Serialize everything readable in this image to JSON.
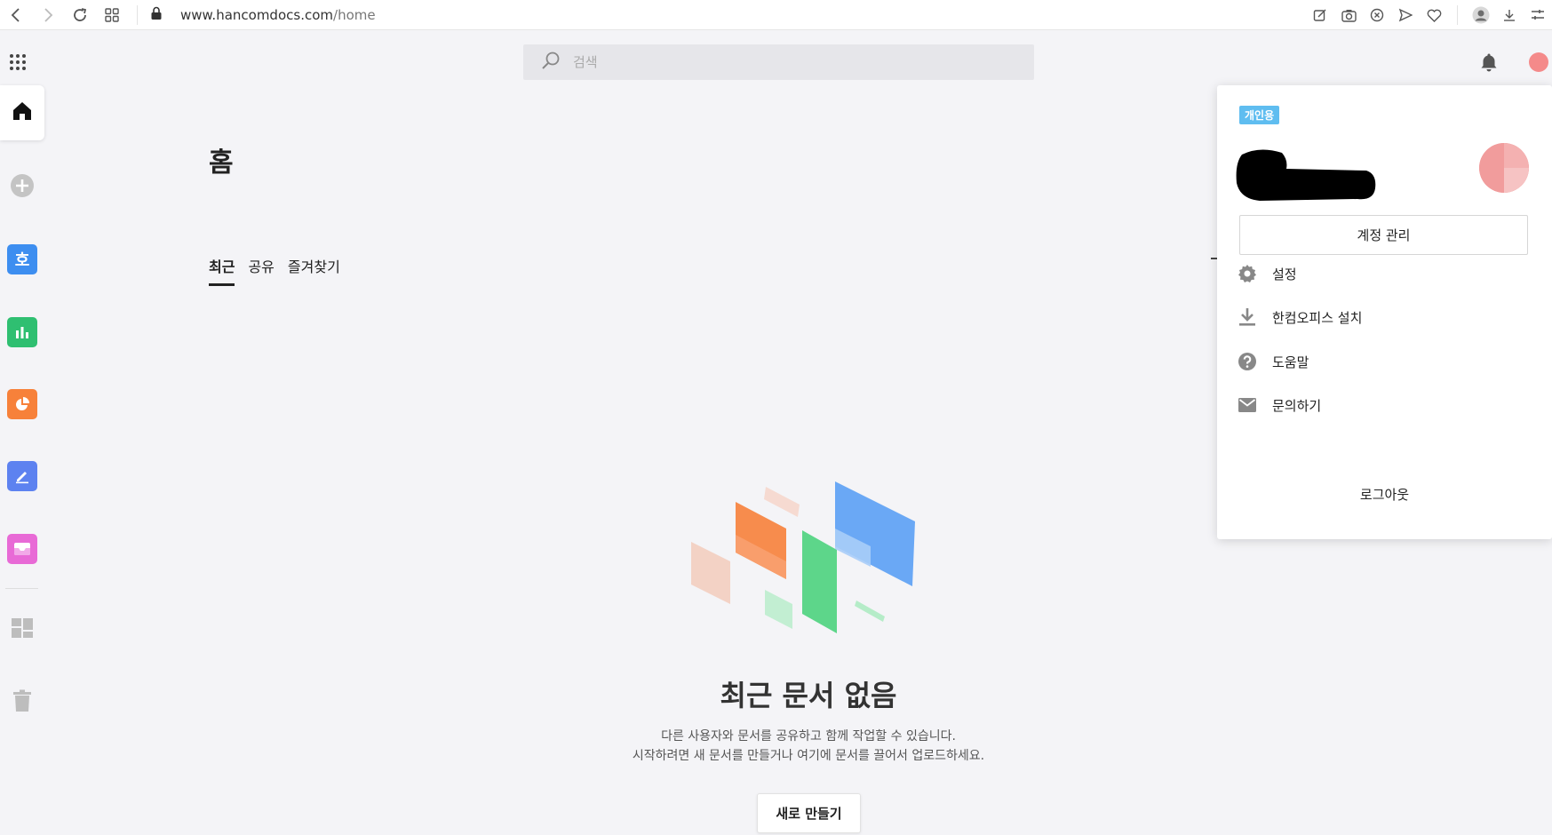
{
  "browser": {
    "url_host": "www.hancomdocs.com",
    "url_path": "/home",
    "nav_icons": [
      "back-icon",
      "forward-icon",
      "reload-icon",
      "tabs-grid-icon",
      "lock-icon"
    ],
    "toolbar_icons": [
      "share-edit-icon",
      "camera-icon",
      "close-circle-icon",
      "send-icon",
      "heart-icon",
      "user-icon",
      "download-icon",
      "settings-sliders-icon"
    ]
  },
  "header": {
    "search_placeholder": "검색"
  },
  "sidebar": {
    "items": [
      {
        "name": "home",
        "color": "#222222"
      },
      {
        "name": "add",
        "color": "#bdbdbd"
      },
      {
        "name": "hword",
        "color": "#3d8ef0",
        "glyph": "호"
      },
      {
        "name": "hcell",
        "color": "#2fbf71"
      },
      {
        "name": "hshow",
        "color": "#f7813a"
      },
      {
        "name": "hpdf",
        "color": "#5d82f0"
      },
      {
        "name": "inbox",
        "color": "#e86ad6"
      },
      {
        "name": "dashboard",
        "color": "#bdbdbd"
      },
      {
        "name": "trash",
        "color": "#bdbdbd"
      }
    ]
  },
  "main": {
    "title": "홈",
    "tabs": [
      {
        "label": "최근",
        "active": true
      },
      {
        "label": "공유",
        "active": false
      },
      {
        "label": "즐겨찾기",
        "active": false
      }
    ],
    "empty_title": "최근 문서 없음",
    "empty_desc_line1": "다른 사용자와 문서를 공유하고 함께 작업할 수 있습니다.",
    "empty_desc_line2": "시작하려면 새 문서를 만들거나 여기에 문서를 끌어서 업로드하세요.",
    "new_button": "새로 만들기"
  },
  "profile_menu": {
    "badge": "개인용",
    "account_button": "계정 관리",
    "items": [
      {
        "label": "설정",
        "icon": "gear-icon"
      },
      {
        "label": "한컴오피스 설치",
        "icon": "download-icon"
      },
      {
        "label": "도움말",
        "icon": "help-icon"
      },
      {
        "label": "문의하기",
        "icon": "mail-icon"
      }
    ],
    "logout": "로그아웃"
  },
  "colors": {
    "accent_badge": "#5fbdf0",
    "avatar": "#f19c9c",
    "background": "#f4f4f7"
  }
}
